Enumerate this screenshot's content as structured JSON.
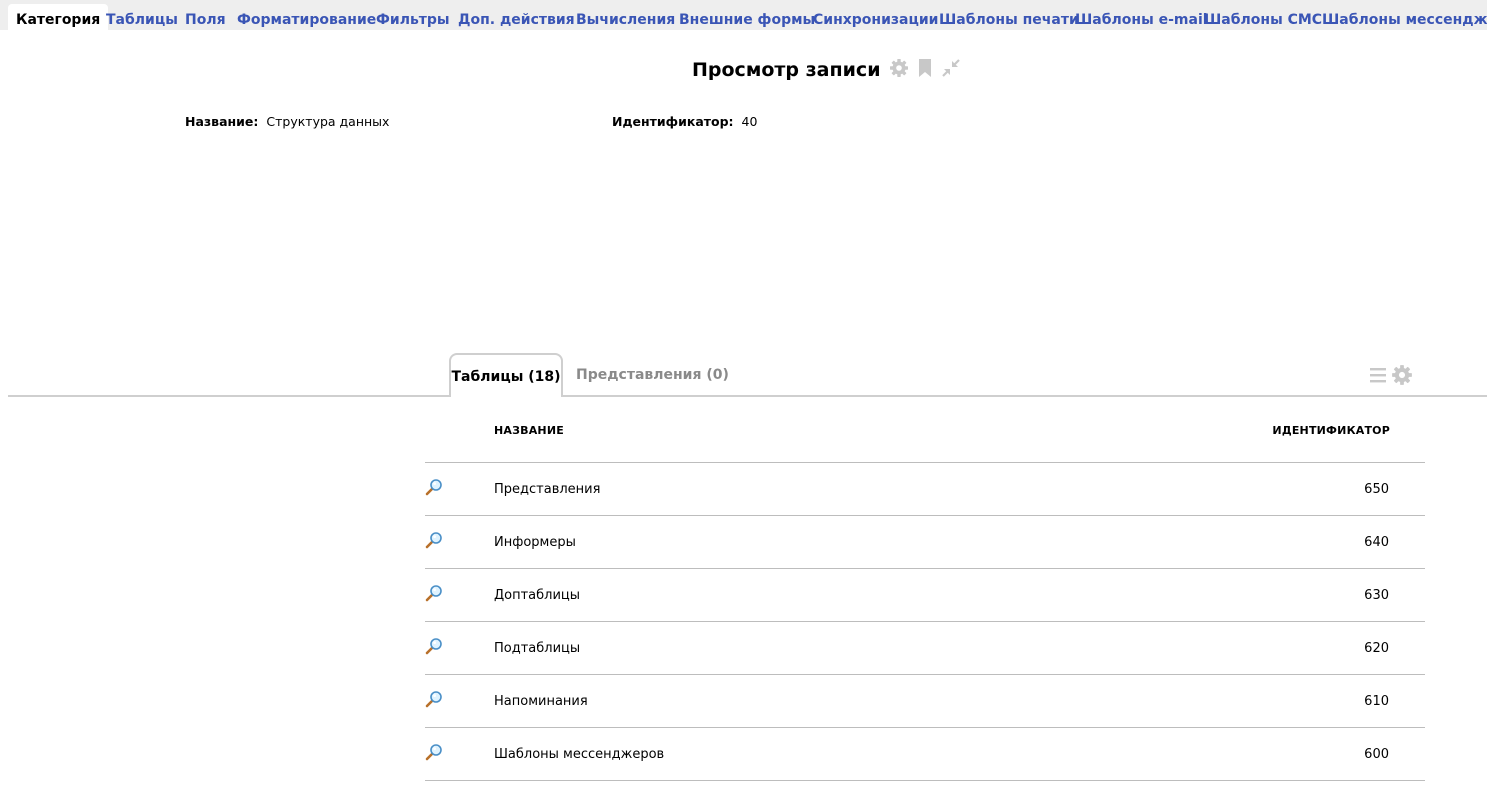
{
  "nav": {
    "items": [
      {
        "label": "Категория",
        "active": true
      },
      {
        "label": "Таблицы"
      },
      {
        "label": "Поля"
      },
      {
        "label": "Форматирование"
      },
      {
        "label": "Фильтры"
      },
      {
        "label": "Доп. действия"
      },
      {
        "label": "Вычисления"
      },
      {
        "label": "Внешние формы"
      },
      {
        "label": "Синхронизации"
      },
      {
        "label": "Шаблоны печати"
      },
      {
        "label": "Шаблоны e-mail"
      },
      {
        "label": "Шаблоны СМС"
      },
      {
        "label": "Шаблоны мессенджеров"
      }
    ]
  },
  "header": {
    "title": "Просмотр записи",
    "icons": [
      "gear-icon",
      "bookmark-icon",
      "collapse-icon"
    ]
  },
  "fields": {
    "name_label": "Название:",
    "name_value": "Структура данных",
    "id_label": "Идентификатор:",
    "id_value": "40"
  },
  "subtabs": {
    "tables": "Таблицы (18)",
    "views": "Представления (0)"
  },
  "table": {
    "columns": {
      "name": "НАЗВАНИЕ",
      "id": "ИДЕНТИФИКАТОР"
    },
    "rows": [
      {
        "name": "Представления",
        "id": "650"
      },
      {
        "name": "Информеры",
        "id": "640"
      },
      {
        "name": "Доптаблицы",
        "id": "630"
      },
      {
        "name": "Подтаблицы",
        "id": "620"
      },
      {
        "name": "Напоминания",
        "id": "610"
      },
      {
        "name": "Шаблоны мессенджеров",
        "id": "600"
      }
    ]
  },
  "colors": {
    "nav_link": "#3a55b5",
    "icon_grey": "#c8c8c8",
    "inactive_tab": "#8a8a8a"
  }
}
